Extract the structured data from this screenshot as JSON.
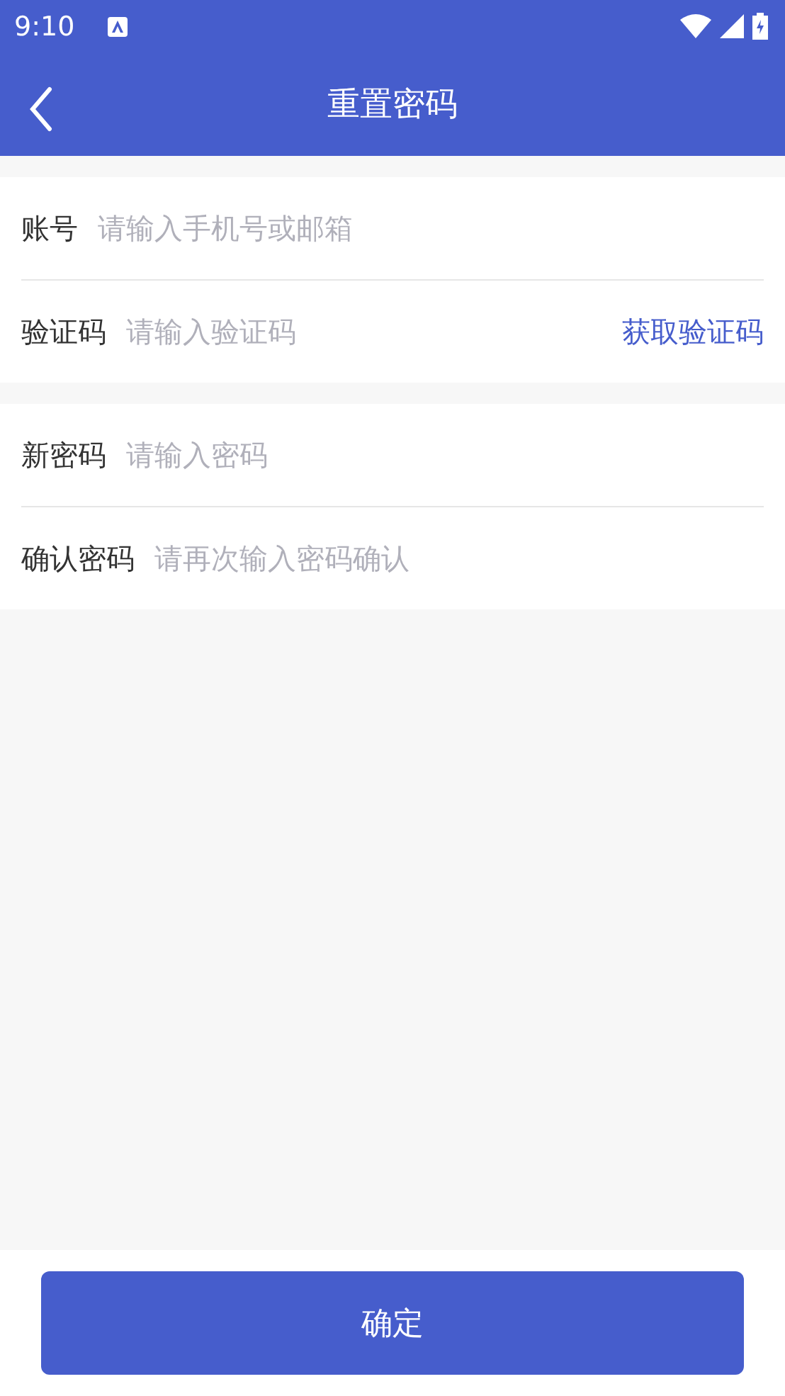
{
  "status_bar": {
    "time": "9:10"
  },
  "header": {
    "title": "重置密码"
  },
  "groups": [
    {
      "fields": [
        {
          "label": "账号",
          "placeholder": "请输入手机号或邮箱"
        },
        {
          "label": "验证码",
          "placeholder": "请输入验证码",
          "action": "获取验证码"
        }
      ]
    },
    {
      "fields": [
        {
          "label": "新密码",
          "placeholder": "请输入密码"
        },
        {
          "label": "确认密码",
          "placeholder": "请再次输入密码确认"
        }
      ]
    }
  ],
  "submit": {
    "label": "确定"
  }
}
